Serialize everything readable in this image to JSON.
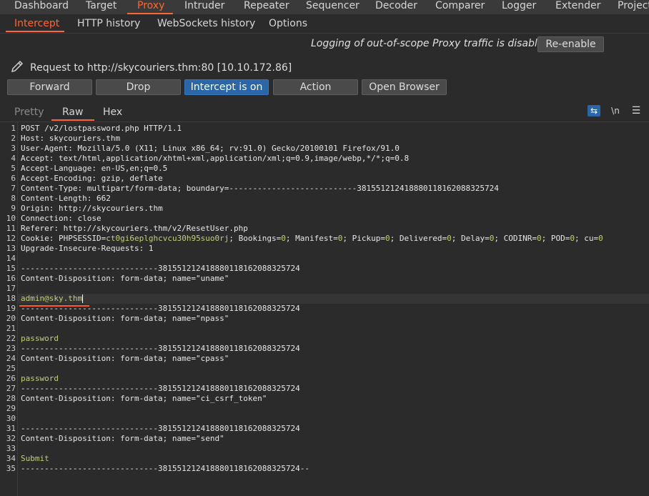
{
  "top_tabs": [
    "Dashboard",
    "Target",
    "Proxy",
    "Intruder",
    "Repeater",
    "Sequencer",
    "Decoder",
    "Comparer",
    "Logger",
    "Extender",
    "Project"
  ],
  "proxy_tabs": [
    "Intercept",
    "HTTP history",
    "WebSockets history",
    "Options"
  ],
  "log_message": "Logging of out-of-scope Proxy traffic is disabled",
  "reenable_label": "Re-enable",
  "request_label": "Request to http://skycouriers.thm:80  [10.10.172.86]",
  "actions": {
    "forward": "Forward",
    "drop": "Drop",
    "intercept": "Intercept is on",
    "action": "Action",
    "open_browser": "Open Browser"
  },
  "editor_tabs": [
    "Pretty",
    "Raw",
    "Hex"
  ],
  "newline_label": "\\n",
  "menu_icon": "☰",
  "wrap_icon": "⇆",
  "line_numbers": [
    "1",
    "2",
    "3",
    "4",
    "5",
    "6",
    "7",
    "8",
    "9",
    "10",
    "11",
    "12",
    "13",
    "14",
    "15",
    "16",
    "17",
    "18",
    "19",
    "20",
    "21",
    "22",
    "23",
    "24",
    "25",
    "26",
    "27",
    "28",
    "29",
    "30",
    "31",
    "32",
    "33",
    "34",
    "35"
  ],
  "request": {
    "line1": "POST /v2/lostpassword.php HTTP/1.1",
    "h_host_k": "Host",
    "h_host_v": "skycouriers.thm",
    "h_ua_k": "User-Agent",
    "h_ua_v": "Mozilla/5.0 (X11; Linux x86_64; rv:91.0) Gecko/20100101 Firefox/91.0",
    "h_accept_k": "Accept",
    "h_accept_v": "text/html,application/xhtml+xml,application/xml;q=0.9,image/webp,*/*;q=0.8",
    "h_lang_k": "Accept-Language",
    "h_lang_v": "en-US,en;q=0.5",
    "h_enc_k": "Accept-Encoding",
    "h_enc_v": "gzip, deflate",
    "h_ct_k": "Content-Type",
    "h_ct_v": "multipart/form-data; boundary=---------------------------381551212418880118162088325724",
    "h_cl_k": "Content-Length",
    "h_cl_v": "662",
    "h_origin_k": "Origin",
    "h_origin_v": "http://skycouriers.thm",
    "h_conn_k": "Connection",
    "h_conn_v": "close",
    "h_ref_k": "Referer",
    "h_ref_v": "http://skycouriers.thm/v2/ResetUser.php",
    "h_cookie_k": "Cookie",
    "cookie": {
      "phpsessid_k": "PHPSESSID",
      "phpsessid_v": "ct0gi6eplghcvcu30h95suo0rj",
      "bookings_k": "Bookings",
      "bookings_v": "0",
      "manifest_k": "Manifest",
      "manifest_v": "0",
      "pickup_k": "Pickup",
      "pickup_v": "0",
      "delivered_k": "Delivered",
      "delivered_v": "0",
      "delay_k": "Delay",
      "delay_v": "0",
      "codinr_k": "CODINR",
      "codinr_v": "0",
      "pod_k": "POD",
      "pod_v": "0",
      "cu_k": "cu",
      "cu_v": "0"
    },
    "h_upg_k": "Upgrade-Insecure-Requests",
    "h_upg_v": "1",
    "boundary": "-----------------------------381551212418880118162088325724",
    "boundary_end": "-----------------------------381551212418880118162088325724--",
    "cd_prefix": "Content-Disposition: form-data; name=",
    "name_uname": "\"uname\"",
    "val_uname": "admin@sky.thm",
    "name_npass": "\"npass\"",
    "val_npass": "password",
    "name_cpass": "\"cpass\"",
    "val_cpass": "password",
    "name_csrf": "\"ci_csrf_token\"",
    "name_send": "\"send\"",
    "val_send": "Submit"
  }
}
